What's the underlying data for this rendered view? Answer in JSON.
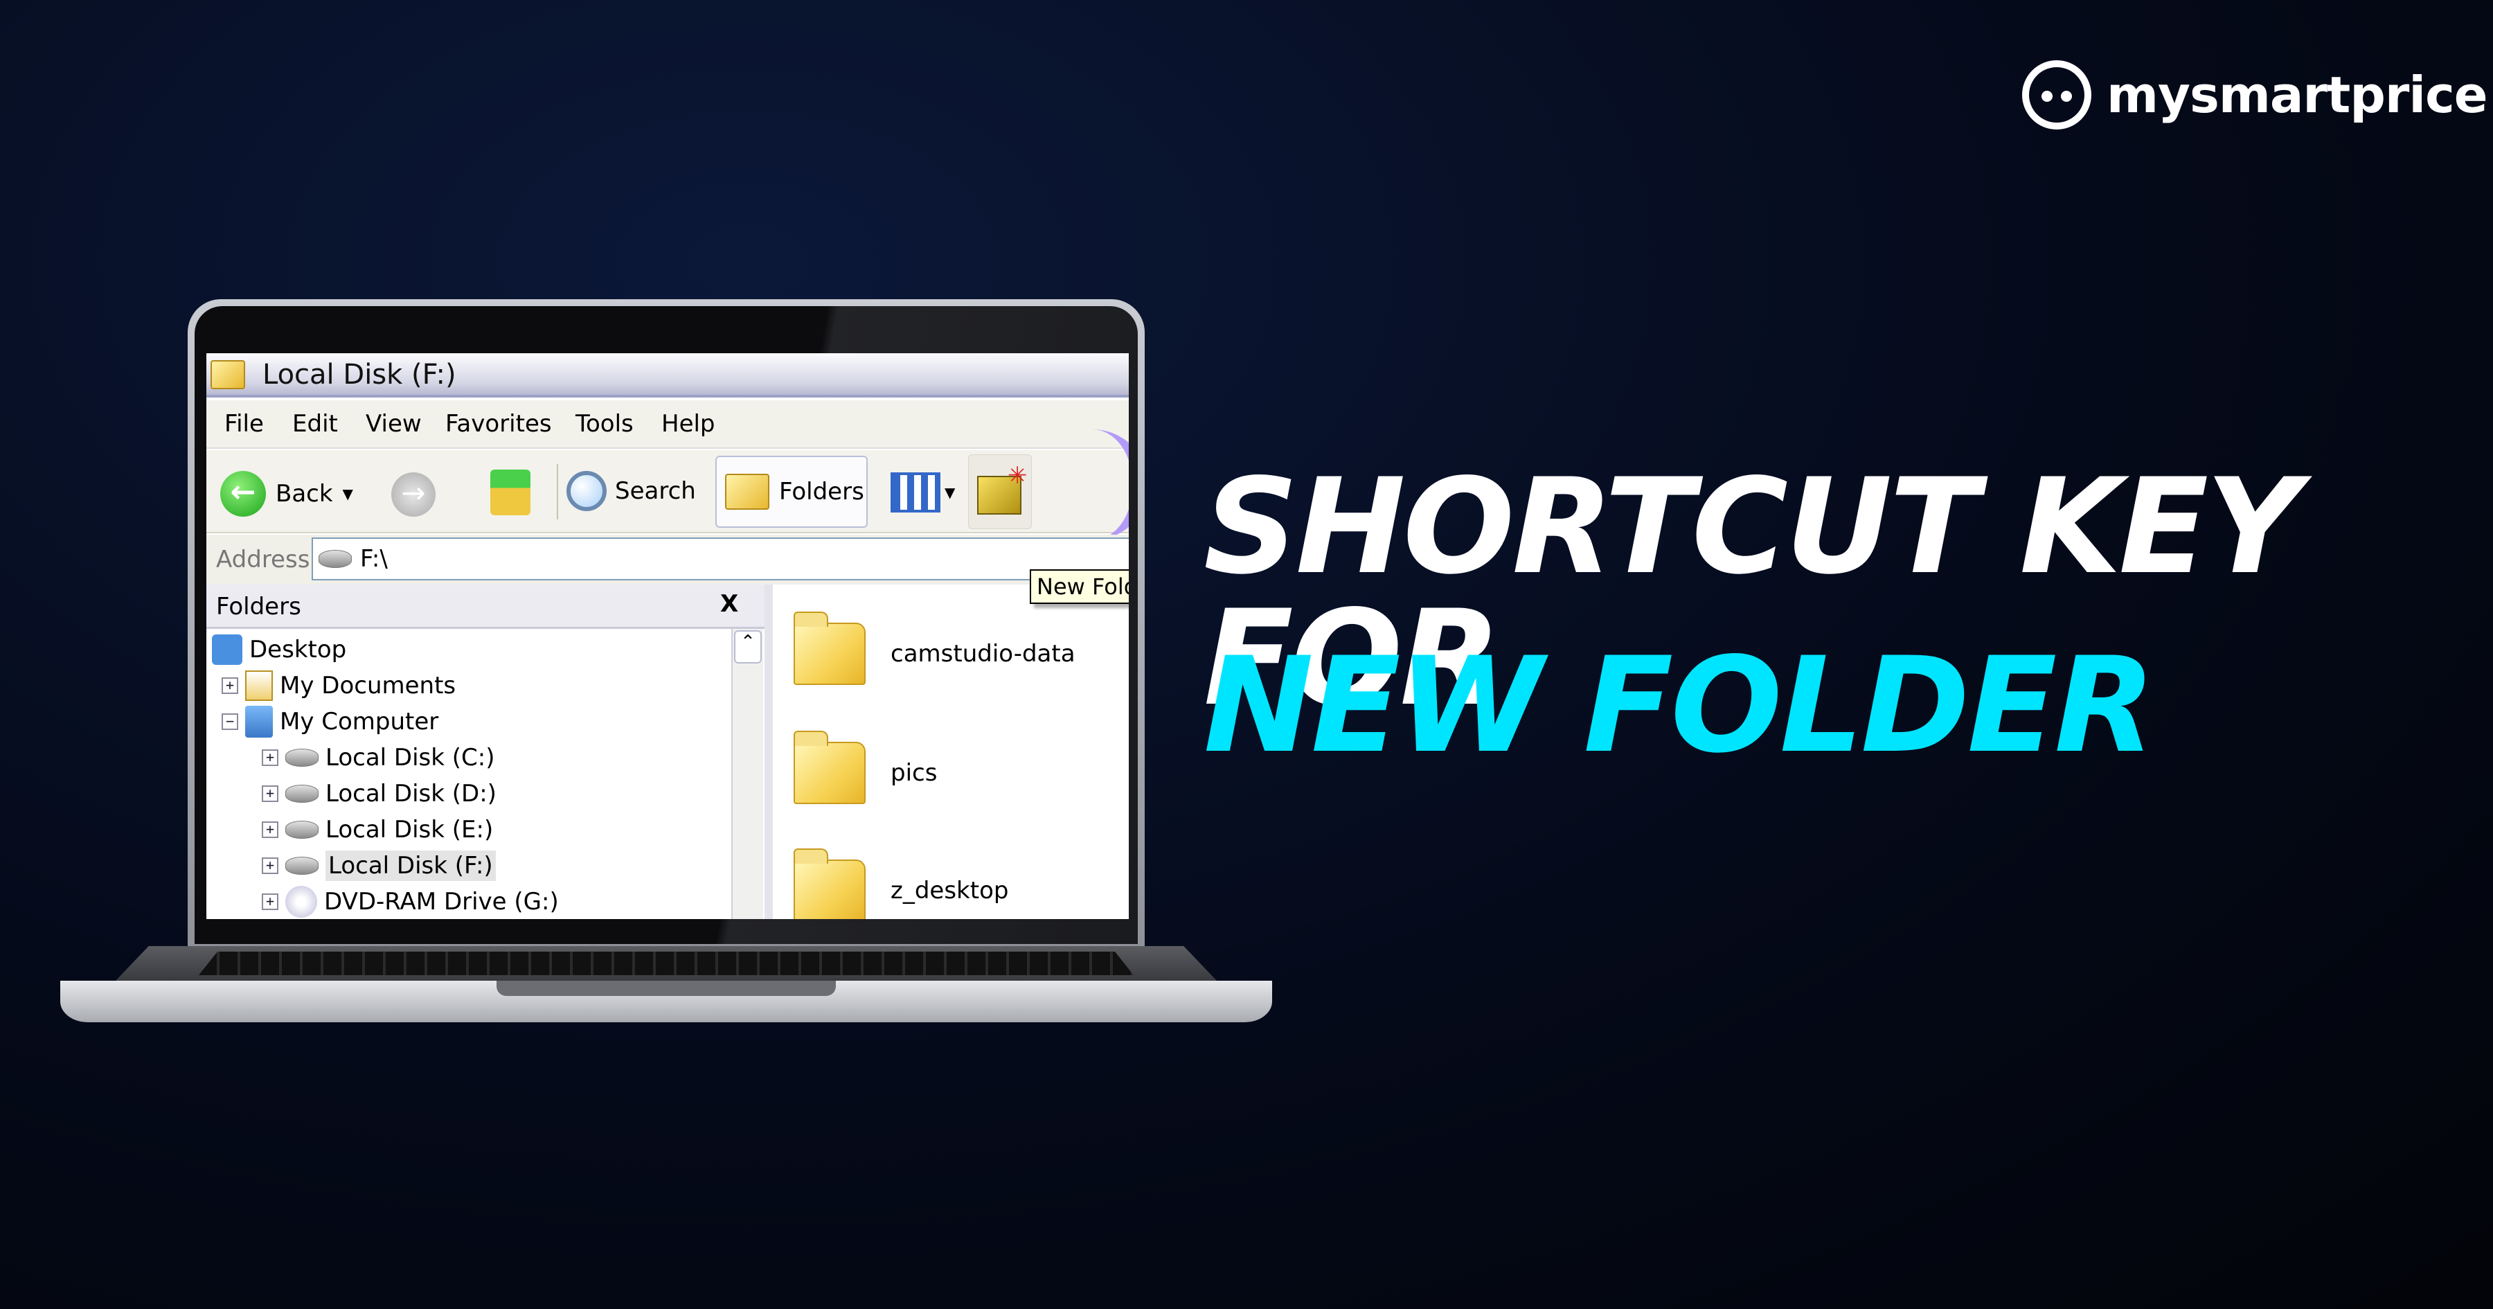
{
  "brand": {
    "name": "mysmartprice",
    "logo_icon": "owl-icon"
  },
  "headline": {
    "line1": "SHORTCUT KEY FOR",
    "line2": "NEW FOLDER",
    "line1_color": "#ffffff",
    "line2_color": "#00e5ff"
  },
  "window": {
    "title": "Local Disk (F:)",
    "menu": [
      "File",
      "Edit",
      "View",
      "Favorites",
      "Tools",
      "Help"
    ],
    "toolbar": {
      "back": "Back",
      "search": "Search",
      "folders": "Folders"
    },
    "tooltip": "New Folder",
    "address": {
      "label": "Address",
      "value": "F:\\"
    },
    "folders_pane": {
      "title": "Folders",
      "close": "X"
    },
    "tree": [
      "Desktop",
      "My Documents",
      "My Computer",
      "Local Disk (C:)",
      "Local Disk (D:)",
      "Local Disk (E:)",
      "Local Disk (F:)",
      "DVD-RAM Drive (G:)"
    ],
    "files": [
      "camstudio-data",
      "pics",
      "z_desktop"
    ]
  }
}
